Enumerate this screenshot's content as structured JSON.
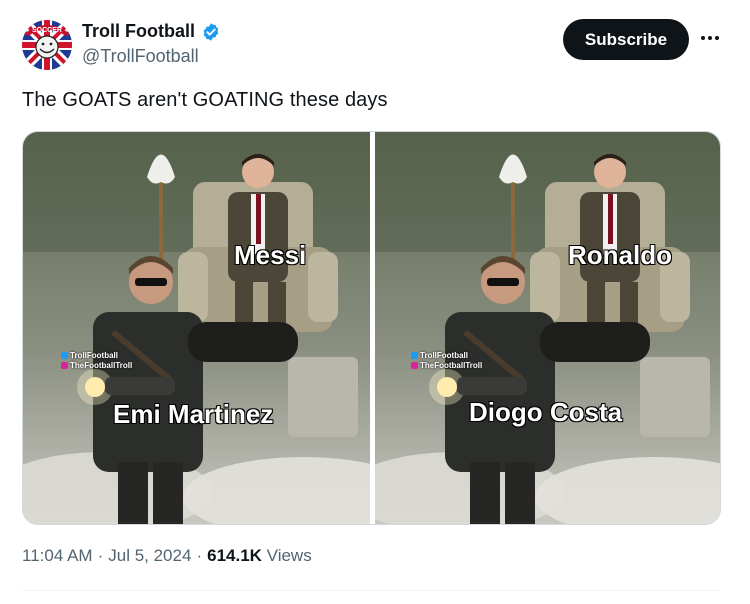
{
  "author": {
    "display_name": "Troll Football",
    "handle": "@TrollFootball",
    "verified": true,
    "avatar_icon": "troll-face-union-jack-logo",
    "avatar_text": "SOCCER"
  },
  "actions": {
    "subscribe_label": "Subscribe",
    "more_icon": "more-dots-icon"
  },
  "tweet": {
    "text": "The GOATS aren't GOATING these days"
  },
  "media": {
    "panels": [
      {
        "top_label": "Messi",
        "bottom_label": "Emi Martinez",
        "watermark_1": "TrollFootball",
        "watermark_2": "TheFootballTroll"
      },
      {
        "top_label": "Ronaldo",
        "bottom_label": "Diogo Costa",
        "watermark_1": "TrollFootball",
        "watermark_2": "TheFootballTroll"
      }
    ]
  },
  "meta": {
    "time": "11:04 AM",
    "sep1": "·",
    "date": "Jul 5, 2024",
    "sep2": "·",
    "views_count": "614.1K",
    "views_label": "Views"
  },
  "colors": {
    "text_primary": "#0f1419",
    "text_secondary": "#536471",
    "verified_blue": "#1d9bf0",
    "button_bg": "#0f1419",
    "border": "#cfd9de"
  }
}
